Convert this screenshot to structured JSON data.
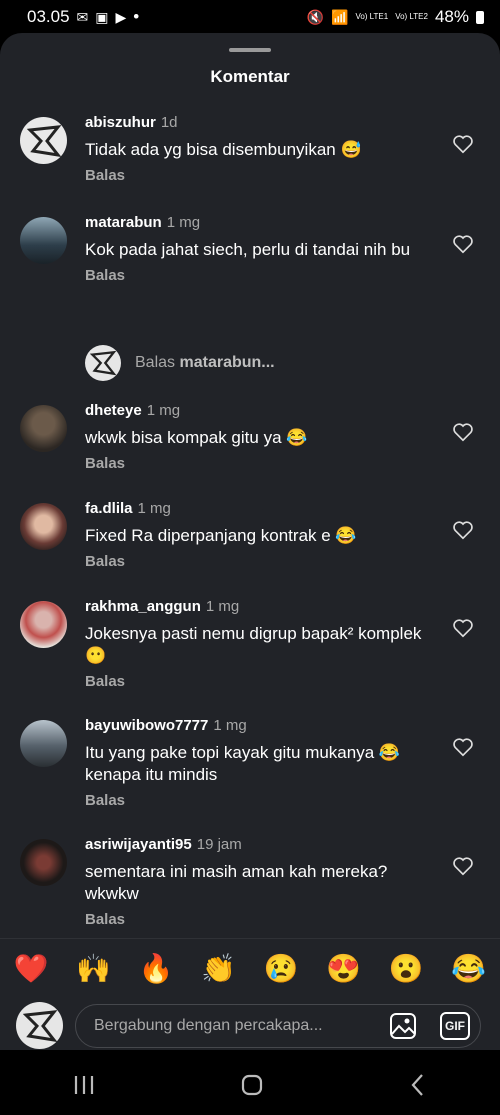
{
  "status": {
    "time": "03.05",
    "lte1": "Vo) LTE1",
    "lte2": "Vo) LTE2",
    "battery": "48%"
  },
  "sheet": {
    "title": "Komentar"
  },
  "comments": [
    {
      "user": "abiszuhur",
      "time": "1d",
      "text": "Tidak ada yg bisa disembunyikan 😅",
      "reply": "Balas"
    },
    {
      "user": "matarabun",
      "time": "1 mg",
      "text": "Kok pada jahat siech, perlu di tandai nih bu",
      "reply": "Balas"
    },
    {
      "user": "dheteye",
      "time": "1 mg",
      "text": "wkwk bisa kompak gitu ya 😂",
      "reply": "Balas"
    },
    {
      "user": "fa.dlila",
      "time": "1 mg",
      "text": "Fixed Ra diperpanjang kontrak e 😂",
      "reply": "Balas"
    },
    {
      "user": "rakhma_anggun",
      "time": "1 mg",
      "text": "Jokesnya pasti nemu digrup bapak² komplek 😶",
      "reply": "Balas"
    },
    {
      "user": "bayuwibowo7777",
      "time": "1 mg",
      "text": "Itu yang pake topi kayak gitu mukanya 😂 kenapa itu mindis",
      "reply": "Balas"
    },
    {
      "user": "asriwijayanti95",
      "time": "19 jam",
      "text": "sementara ini masih aman kah mereka? wkwkw",
      "reply": "Balas"
    }
  ],
  "view_reply": {
    "prefix": "Balas",
    "user": "matarabun..."
  },
  "reactions": [
    "❤️",
    "🙌",
    "🔥",
    "👏",
    "😢",
    "😍",
    "😮",
    "😂"
  ],
  "composer": {
    "placeholder": "Bergabung dengan percakapa...",
    "gif_label": "GIF"
  },
  "icons": {
    "heart": "heart-outline-icon",
    "image": "image-icon",
    "nav_recents": "recents-icon",
    "nav_home": "home-icon",
    "nav_back": "back-icon"
  }
}
